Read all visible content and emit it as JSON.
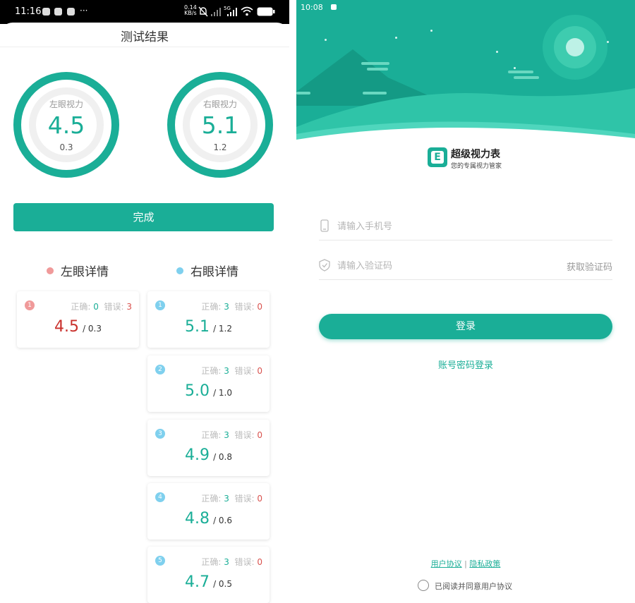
{
  "colors": {
    "accent": "#1aae97",
    "error": "#d9534f",
    "left_dot": "#f09a9a",
    "right_dot": "#7fd0ee"
  },
  "left": {
    "status": {
      "time": "11:16",
      "more": "···",
      "speed_value": "0.14",
      "speed_unit": "KB/s",
      "network": "5G"
    },
    "title": "测试结果",
    "rings": [
      {
        "label": "左眼视力",
        "score": "4.5",
        "decimal": "0.3"
      },
      {
        "label": "右眼视力",
        "score": "5.1",
        "decimal": "1.2"
      }
    ],
    "done_label": "完成",
    "left_header": "左眼详情",
    "right_header": "右眼详情",
    "correct_label": "正确:",
    "wrong_label": "错误:",
    "left_cards": [
      {
        "index": "1",
        "correct": "0",
        "wrong": "3",
        "score": "4.5",
        "decimal": "/ 0.3"
      }
    ],
    "right_cards": [
      {
        "index": "1",
        "correct": "3",
        "wrong": "0",
        "score": "5.1",
        "decimal": "/ 1.2"
      },
      {
        "index": "2",
        "correct": "3",
        "wrong": "0",
        "score": "5.0",
        "decimal": "/ 1.0"
      },
      {
        "index": "3",
        "correct": "3",
        "wrong": "0",
        "score": "4.9",
        "decimal": "/ 0.8"
      },
      {
        "index": "4",
        "correct": "3",
        "wrong": "0",
        "score": "4.8",
        "decimal": "/ 0.6"
      },
      {
        "index": "5",
        "correct": "3",
        "wrong": "0",
        "score": "4.7",
        "decimal": "/ 0.5"
      }
    ]
  },
  "right": {
    "status": {
      "time": "10:08"
    },
    "logo_letter": "E",
    "app_name": "超级视力表",
    "app_slogan": "您的专属视力管家",
    "phone_placeholder": "请输入手机号",
    "code_placeholder": "请输入验证码",
    "get_code": "获取验证码",
    "login_label": "登录",
    "password_login": "账号密码登录",
    "user_agreement": "用户协议",
    "separator": "|",
    "privacy_policy": "隐私政策",
    "agree_text": "已阅读并同意用户协议"
  }
}
